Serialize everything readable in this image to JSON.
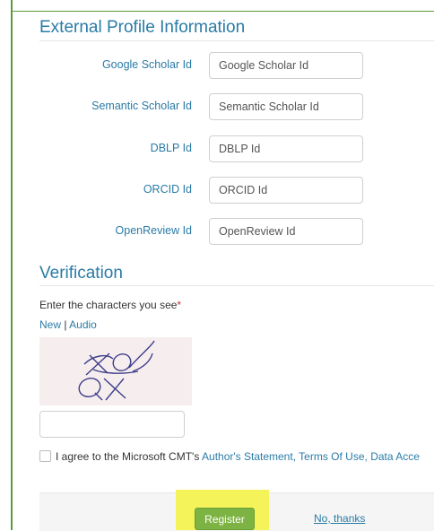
{
  "external_profile": {
    "title": "External Profile Information",
    "fields": [
      {
        "label": "Google Scholar Id",
        "placeholder": "Google Scholar Id",
        "value": ""
      },
      {
        "label": "Semantic Scholar Id",
        "placeholder": "Semantic Scholar Id",
        "value": ""
      },
      {
        "label": "DBLP Id",
        "placeholder": "DBLP Id",
        "value": ""
      },
      {
        "label": "ORCID Id",
        "placeholder": "ORCID Id",
        "value": ""
      },
      {
        "label": "OpenReview Id",
        "placeholder": "OpenReview Id",
        "value": ""
      }
    ]
  },
  "verification": {
    "title": "Verification",
    "prompt": "Enter the characters you see",
    "required_marker": "*",
    "new_link": "New",
    "separator": "|",
    "audio_link": "Audio",
    "captcha_text": "XoQX",
    "captcha_value": ""
  },
  "agreement": {
    "prefix": "I agree to the Microsoft CMT's",
    "authors_statement": "Author's Statement,",
    "terms_of_use": "Terms Of Use,",
    "data_access": "Data Acce"
  },
  "footer": {
    "register_label": "Register",
    "no_thanks_label": "No, thanks"
  },
  "colors": {
    "link": "#2a7ba6",
    "register_bg": "#7cb342",
    "highlight": "#f4f45a",
    "frame": "#5a9a3c"
  }
}
